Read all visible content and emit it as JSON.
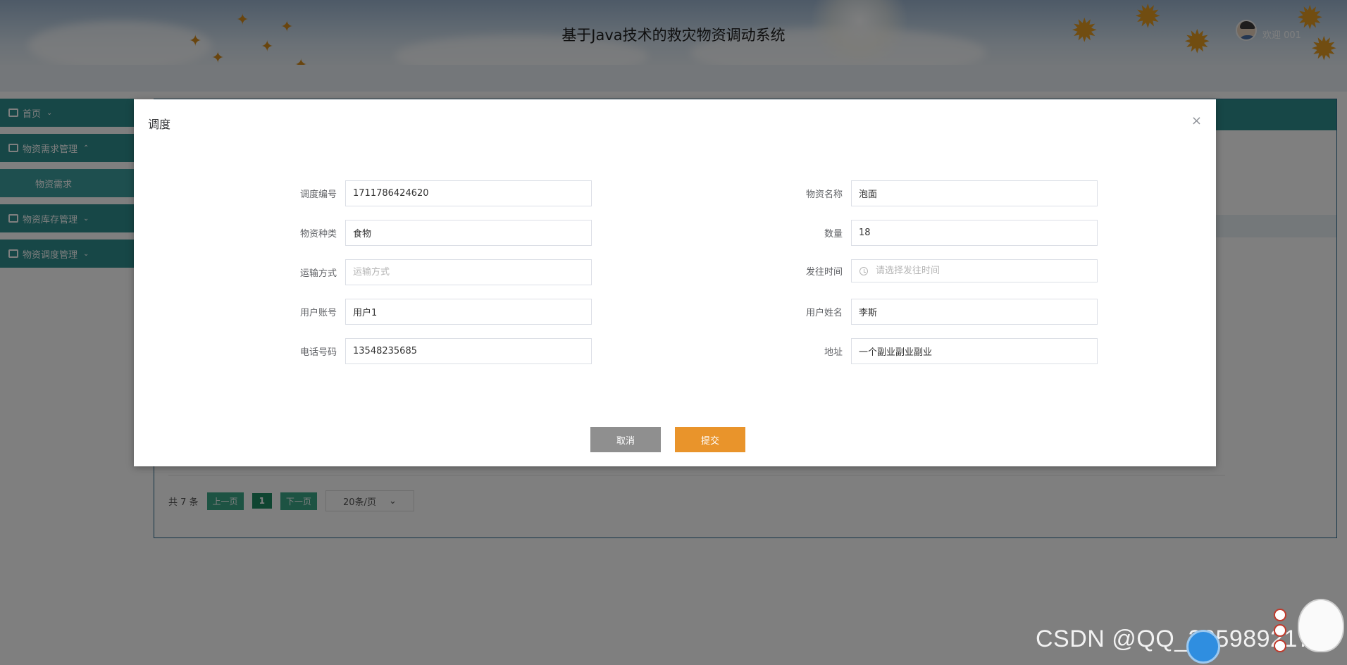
{
  "header": {
    "title": "基于Java技术的救灾物资调动系统",
    "welcome": "欢迎 001"
  },
  "sidebar": {
    "items": [
      {
        "label": "首页",
        "expanded": false
      },
      {
        "label": "物资需求管理",
        "expanded": true,
        "children": [
          {
            "label": "物资需求"
          }
        ]
      },
      {
        "label": "物资库存管理",
        "expanded": false
      },
      {
        "label": "物资调度管理",
        "expanded": false
      }
    ]
  },
  "pagination": {
    "total": "共 7 条",
    "prev": "上一页",
    "current": "1",
    "next": "下一页",
    "page_size": "20条/页"
  },
  "dialog": {
    "title": "调度",
    "close": "×",
    "fields": {
      "dispatch_no": {
        "label": "调度编号",
        "value": "1711786424620",
        "placeholder": ""
      },
      "material_name": {
        "label": "物资名称",
        "value": "泡面",
        "placeholder": ""
      },
      "material_type": {
        "label": "物资种类",
        "value": "食物",
        "placeholder": ""
      },
      "quantity": {
        "label": "数量",
        "value": "18",
        "placeholder": ""
      },
      "transport": {
        "label": "运输方式",
        "value": "",
        "placeholder": "运输方式"
      },
      "send_time": {
        "label": "发往时间",
        "value": "",
        "placeholder": "请选择发往时间"
      },
      "user_account": {
        "label": "用户账号",
        "value": "用户1",
        "placeholder": ""
      },
      "user_name": {
        "label": "用户姓名",
        "value": "李斯",
        "placeholder": ""
      },
      "phone": {
        "label": "电话号码",
        "value": "13548235685",
        "placeholder": ""
      },
      "address": {
        "label": "地址",
        "value": "一个副业副业副业",
        "placeholder": ""
      }
    },
    "buttons": {
      "cancel": "取消",
      "submit": "提交"
    }
  },
  "watermark": "CSDN @QQ_3359892174",
  "colors": {
    "sidebar_bg": "#2f8f8f",
    "submit_btn": "#e9942b",
    "cancel_btn": "#8f8f8f",
    "pager_btn": "#3aa687",
    "overlay": "rgba(0,0,0,0.5)"
  }
}
